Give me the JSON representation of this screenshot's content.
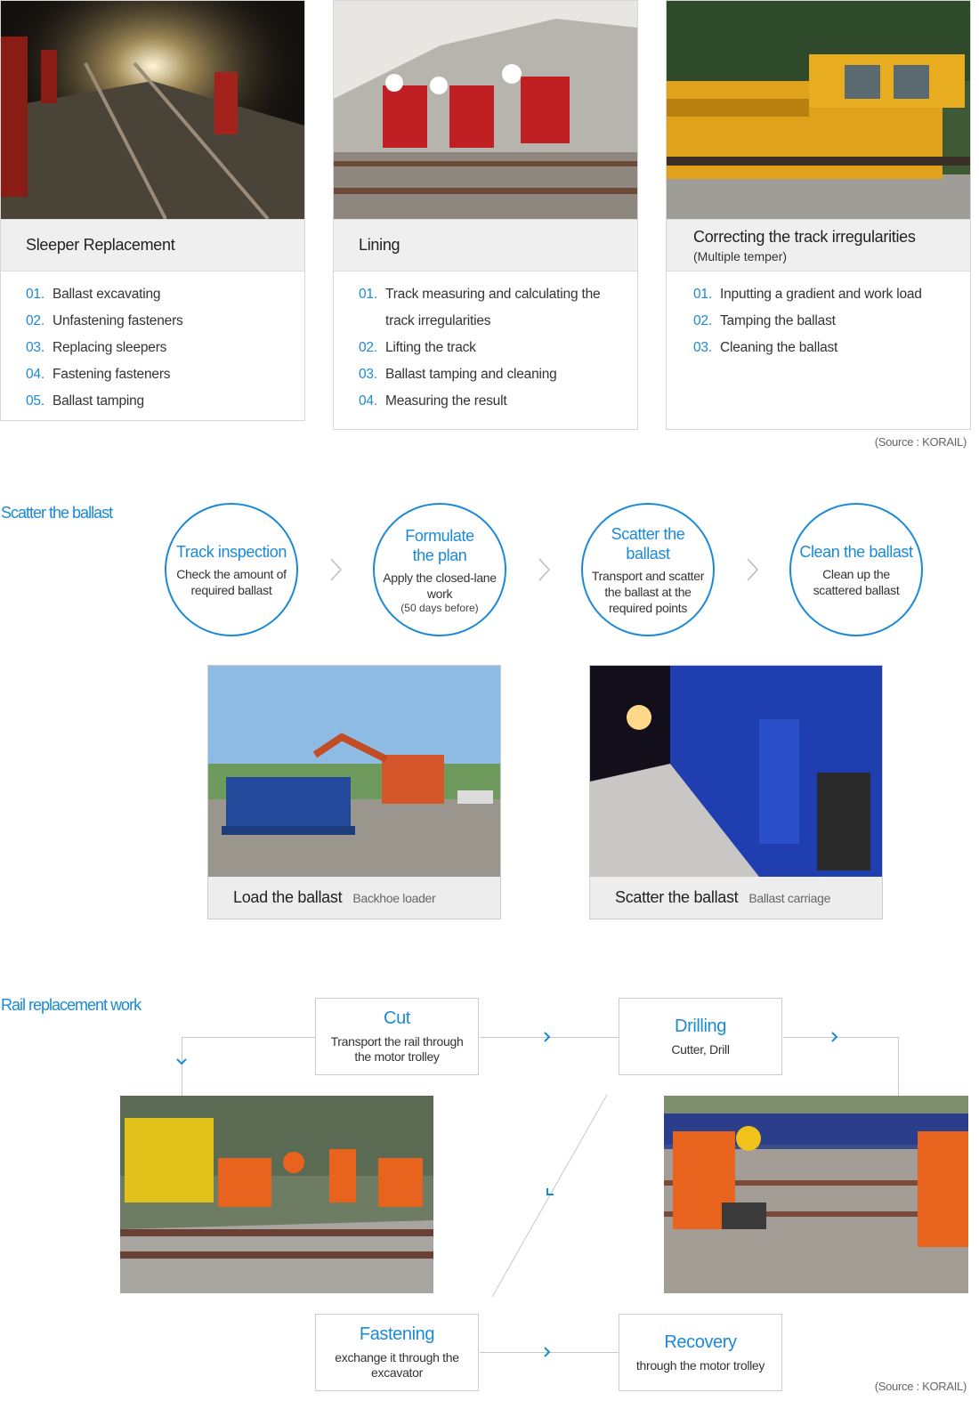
{
  "cards": [
    {
      "title": "Sleeper Replacement",
      "subtitle": "",
      "photo_icon": "night-track-work-photo",
      "steps": [
        {
          "num": "01.",
          "text": "Ballast excavating"
        },
        {
          "num": "02.",
          "text": "Unfastening fasteners"
        },
        {
          "num": "03.",
          "text": "Replacing sleepers"
        },
        {
          "num": "04.",
          "text": "Fastening fasteners"
        },
        {
          "num": "05.",
          "text": "Ballast tamping"
        }
      ]
    },
    {
      "title": "Lining",
      "subtitle": "",
      "photo_icon": "workers-lining-photo",
      "steps": [
        {
          "num": "01.",
          "text": "Track measuring and calculating the track irregularities"
        },
        {
          "num": "02.",
          "text": "Lifting the track"
        },
        {
          "num": "03.",
          "text": "Ballast tamping and cleaning"
        },
        {
          "num": "04.",
          "text": "Measuring the result"
        }
      ]
    },
    {
      "title": "Correcting the track irregularities",
      "subtitle": "(Multiple temper)",
      "photo_icon": "tamper-machine-photo",
      "steps": [
        {
          "num": "01.",
          "text": "Inputting a gradient and work load"
        },
        {
          "num": "02.",
          "text": "Tamping the ballast"
        },
        {
          "num": "03.",
          "text": "Cleaning the ballast"
        }
      ]
    }
  ],
  "source_top": "(Source : KORAIL)",
  "scatter": {
    "heading": "Scatter the ballast",
    "steps": [
      {
        "title": "Track inspection",
        "desc": "Check the amount of required ballast",
        "note": ""
      },
      {
        "title": "Formulate the plan",
        "desc": "Apply the closed-lane work",
        "note": "(50 days before)"
      },
      {
        "title": "Scatter the ballast",
        "desc": "Transport and scatter the ballast at the required points",
        "note": ""
      },
      {
        "title": "Clean the ballast",
        "desc": "Clean up the scattered ballast",
        "note": ""
      }
    ],
    "photos": [
      {
        "caption": "Load the ballast",
        "sub": "Backhoe loader",
        "icon": "backhoe-loader-photo"
      },
      {
        "caption": "Scatter the ballast",
        "sub": "Ballast carriage",
        "icon": "ballast-carriage-photo"
      }
    ]
  },
  "rail": {
    "heading": "Rail replacement work",
    "steps": [
      {
        "title": "Cut",
        "desc": "Transport the rail through the motor trolley"
      },
      {
        "title": "Drilling",
        "desc": "Cutter, Drill"
      },
      {
        "title": "Fastening",
        "desc": "exchange it through the excavator"
      },
      {
        "title": "Recovery",
        "desc": "through the motor trolley"
      }
    ],
    "photos": [
      {
        "icon": "rail-cutting-photo"
      },
      {
        "icon": "rail-drilling-photo"
      }
    ],
    "source": "(Source : KORAIL)"
  },
  "colors": {
    "accent": "#1b8ad6",
    "panel": "#efefef",
    "border": "#d6d6d6"
  }
}
